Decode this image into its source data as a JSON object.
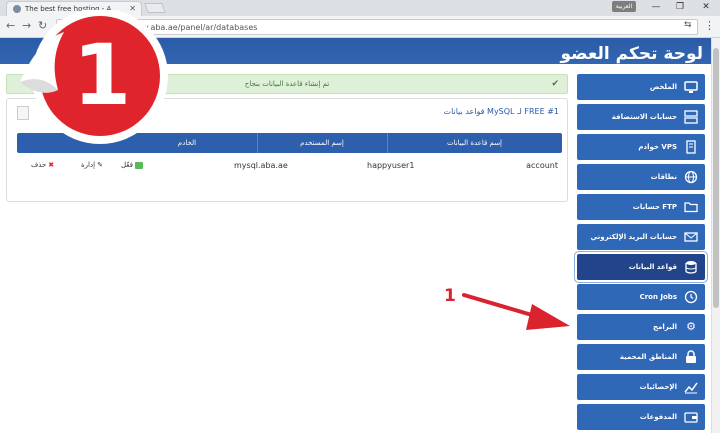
{
  "browser": {
    "tab_title": "The best free hosting - A",
    "url_secure": "S",
    "url_text": "www.aba.ae/panel/ar/databases",
    "lang_badge": "العربية"
  },
  "header": {
    "title": "لوحة تحكم العضو"
  },
  "alert": {
    "message": "تم إنشاء قاعدة البيانات بنجاح"
  },
  "panel": {
    "title": "قواعد بيانات MySQL لـ FREE #1",
    "columns": [
      "إسم قاعدة البيانات",
      "إسم المستخدم",
      "الخادم"
    ],
    "rows": [
      {
        "database": "account",
        "user": "happyuser1",
        "host": "mysql.aba.ae",
        "manage": "إدارة",
        "activate": "فعّل",
        "delete": "حذف"
      }
    ]
  },
  "sidebar": {
    "items": [
      {
        "label": "الملخص",
        "icon": "monitor-icon"
      },
      {
        "label": "حسابات الاستضافة",
        "icon": "server-icon"
      },
      {
        "label": "خوادم VPS",
        "icon": "vps-icon"
      },
      {
        "label": "نطاقات",
        "icon": "globe-icon"
      },
      {
        "label": "حسابات FTP",
        "icon": "folder-icon"
      },
      {
        "label": "حسابات البريد الإلكتروني",
        "icon": "mail-icon"
      },
      {
        "label": "قواعد البيانات",
        "icon": "database-icon"
      },
      {
        "label": "Cron Jobs",
        "icon": "clock-icon"
      },
      {
        "label": "البرامج",
        "icon": "gear-icon"
      },
      {
        "label": "المناطق المحمية",
        "icon": "lock-icon"
      },
      {
        "label": "الإحصائيات",
        "icon": "chart-icon"
      },
      {
        "label": "المدفوعات",
        "icon": "wallet-icon"
      }
    ]
  },
  "annotation": {
    "step_number": "1",
    "big_badge": "1"
  },
  "colors": {
    "brand_blue": "#3068b8",
    "alert_green": "#dff0d8",
    "marker_red": "#d9232d"
  }
}
